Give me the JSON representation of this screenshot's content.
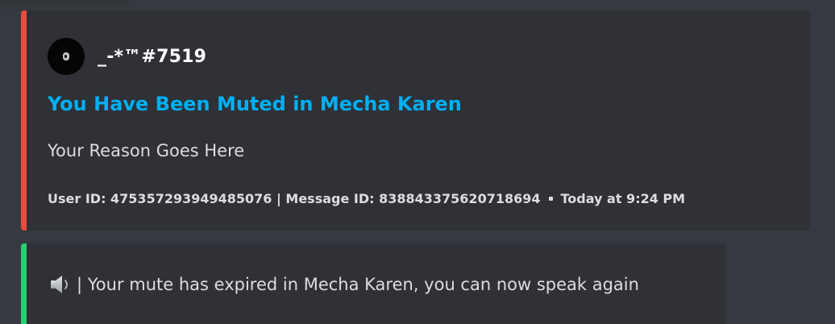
{
  "colors": {
    "background": "#36393f",
    "embed_background": "#2f3136",
    "mute_accent": "#e74c3c",
    "unmute_accent": "#2ecc71",
    "title_link": "#00aff4",
    "text": "#dcddde"
  },
  "mute_embed": {
    "author": {
      "avatar_icon": "avatar-icon",
      "name": "_-*™#7519"
    },
    "title": "You Have Been Muted in Mecha Karen",
    "description": "Your Reason Goes Here",
    "footer": {
      "ids": "User ID: 475357293949485076 | Message ID: 838843375620718694",
      "timestamp": "Today at 9:24 PM"
    }
  },
  "unmute_embed": {
    "icon": "speaker-icon",
    "text": "| Your mute has expired in Mecha Karen, you can now speak again"
  }
}
